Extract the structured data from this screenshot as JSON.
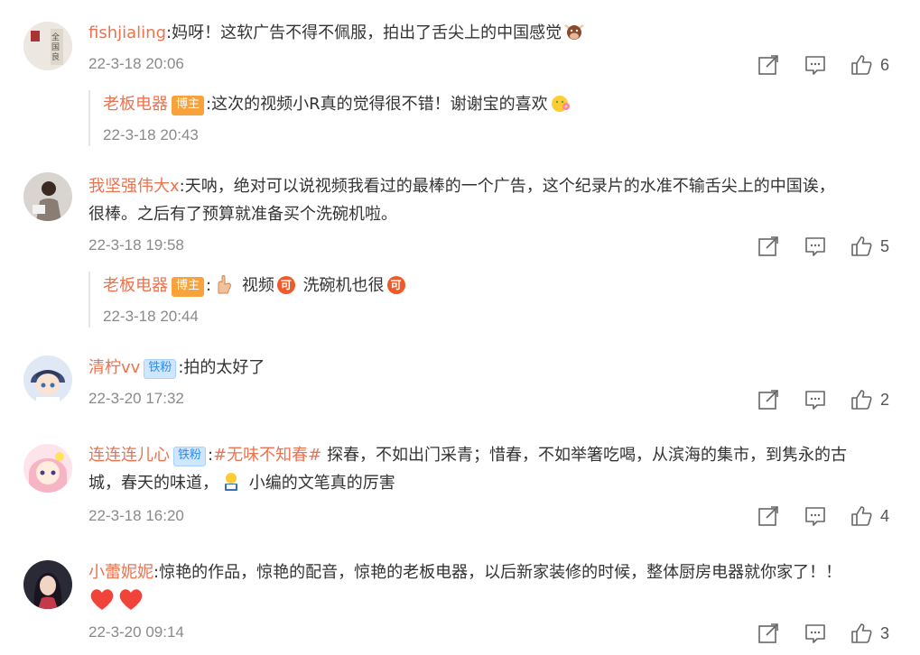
{
  "comments": [
    {
      "username": "fishjialing",
      "text": "妈呀！这软广告不得不佩服，拍出了舌尖上的中国感觉",
      "time": "22-3-18 20:06",
      "likes": "6",
      "emoji_icon": "ox-emoji",
      "reply": {
        "username": "老板电器",
        "badge": "博主",
        "text": "这次的视频小R真的觉得很不错！谢谢宝的喜欢",
        "time": "22-3-18 20:43",
        "emoji_icon": "flower-face-emoji"
      }
    },
    {
      "username": "我坚强伟大x",
      "text_line1": "天呐，绝对可以说视频我看过的最棒的一个广告，这个纪录片的水准不输舌尖上的中国诶，",
      "text_line2": "很棒。之后有了预算就准备买个洗碗机啦。",
      "time": "22-3-18 19:58",
      "likes": "5",
      "reply": {
        "username": "老板电器",
        "badge": "博主",
        "seg1": "视频",
        "seg2": "洗碗机也很",
        "mini_icon_label": "可",
        "time": "22-3-18 20:44"
      }
    },
    {
      "username": "清柠vv",
      "badge": "铁粉",
      "text": "拍的太好了",
      "time": "22-3-20 17:32",
      "likes": "2"
    },
    {
      "username": "连连连儿心",
      "badge": "铁粉",
      "hashtag": "#无味不知春#",
      "text_line1": " 探春，不如出门采青；惜春，不如举箸吃喝，从滨海的集市，到隽永的古",
      "text_line2a": "城，春天的味道，",
      "text_line2b": " 小编的文笔真的厉害",
      "time": "22-3-18 16:20",
      "likes": "4"
    },
    {
      "username": "小蕾妮妮",
      "text": "惊艳的作品，惊艳的配音，惊艳的老板电器，以后新家装修的时候，整体厨房电器就你家了！！",
      "time": "22-3-20 09:14",
      "likes": "3"
    }
  ],
  "colors": {
    "username": "#eb7350",
    "time": "#8a8a8a",
    "badge_blogger": "#f7a23a",
    "badge_fan": "#cfe6ff"
  },
  "icons": [
    "share-icon",
    "comment-icon",
    "like-icon",
    "heart-icon"
  ]
}
